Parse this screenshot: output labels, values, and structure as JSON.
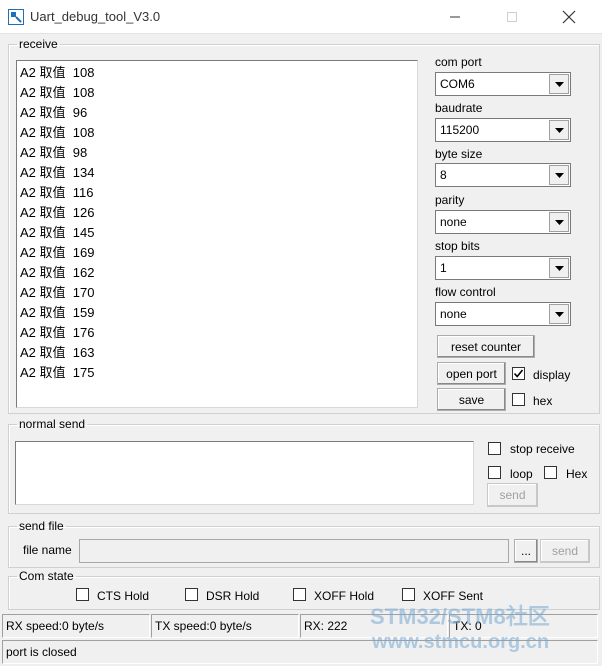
{
  "window": {
    "title": "Uart_debug_tool_V3.0"
  },
  "receive": {
    "legend": "receive",
    "lines": [
      "A2 取值  108",
      "A2 取值  108",
      "A2 取值  96",
      "A2 取值  108",
      "A2 取值  98",
      "A2 取值  134",
      "A2 取值  116",
      "A2 取值  126",
      "A2 取值  145",
      "A2 取值  169",
      "A2 取值  162",
      "A2 取值  170",
      "A2 取值  159",
      "A2 取值  176",
      "A2 取值  163",
      "A2 取值  175"
    ]
  },
  "settings": {
    "com_port": {
      "label": "com port",
      "value": "COM6"
    },
    "baudrate": {
      "label": "baudrate",
      "value": "115200"
    },
    "byte_size": {
      "label": "byte size",
      "value": "8"
    },
    "parity": {
      "label": "parity",
      "value": "none"
    },
    "stop_bits": {
      "label": "stop bits",
      "value": "1"
    },
    "flow_control": {
      "label": "flow control",
      "value": "none"
    }
  },
  "controls": {
    "reset_counter": "reset counter",
    "open_port": "open port",
    "display_label": "display",
    "display_checked": true,
    "save": "save",
    "hex_label": "hex",
    "hex_checked": false
  },
  "normal_send": {
    "legend": "normal send",
    "stop_receive_label": "stop receive",
    "loop_label": "loop",
    "hex_label": "Hex",
    "send_label": "send"
  },
  "send_file": {
    "legend": "send file",
    "file_name_label": "file name",
    "file_name_value": "",
    "browse_label": "...",
    "send_label": "send"
  },
  "com_state": {
    "legend": "Com state",
    "items": [
      "CTS Hold",
      "DSR Hold",
      "XOFF Hold",
      "XOFF Sent"
    ]
  },
  "status": {
    "rx_speed": "RX speed:0 byte/s",
    "tx_speed": "TX speed:0 byte/s",
    "rx_count": "RX: 222",
    "tx_count": "TX: 0",
    "port_state": "port is closed"
  },
  "watermark": {
    "line1": "STM32/STM8社区",
    "line2": "www.stmcu.org.cn"
  },
  "colors": {
    "window_bg": "#f0f0f0",
    "field_bg": "#ffffff",
    "icon_accent": "#1e6fb5"
  }
}
